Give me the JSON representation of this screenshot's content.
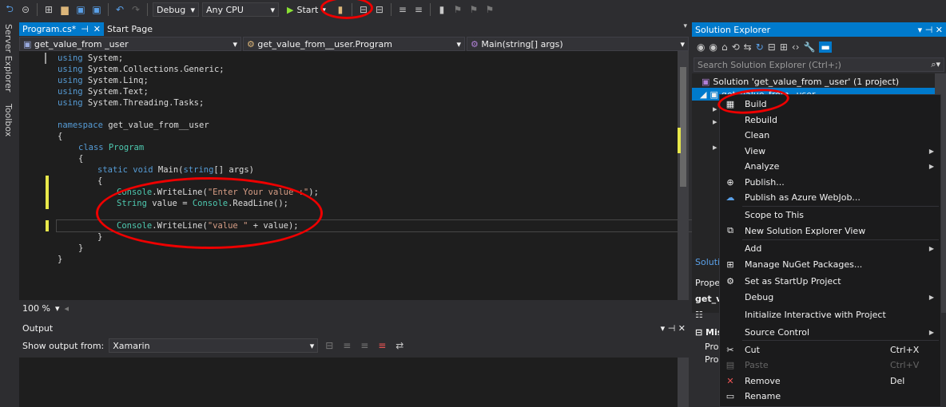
{
  "toolbar": {
    "config": "Debug",
    "platform": "Any CPU",
    "start_label": "Start"
  },
  "left_strip": {
    "server_explorer": "Server Explorer",
    "toolbox": "Toolbox"
  },
  "tabs": [
    {
      "label": "Program.cs*",
      "active": true
    },
    {
      "label": "Start Page",
      "active": false
    }
  ],
  "nav": {
    "project": "get_value_from _user",
    "class": "get_value_from__user.Program",
    "member": "Main(string[] args)"
  },
  "code": {
    "l1": "using System;",
    "l2": "using System.Collections.Generic;",
    "l3": "using System.Linq;",
    "l4": "using System.Text;",
    "l5": "using System.Threading.Tasks;",
    "l7kw": "namespace",
    "l7rest": " get_value_from__user",
    "l8": "{",
    "l9kw": "class",
    "l9ty": " Program",
    "l10": "{",
    "l11a": "static void",
    "l11b": " Main(",
    "l11c": "string",
    "l11d": "[] args)",
    "l12": "{",
    "l13a": "Console",
    "l13b": ".WriteLine(",
    "l13c": "\"Enter Your value :\"",
    "l13d": ");",
    "l14a": "String",
    "l14b": " value = ",
    "l14c": "Console",
    "l14d": ".ReadLine();",
    "l16a": "Console",
    "l16b": ".WriteLine(",
    "l16c": "\"value \"",
    "l16d": " + value);",
    "l17": "}",
    "l18": "}",
    "l19": "}"
  },
  "zoom": "100 %",
  "output": {
    "title": "Output",
    "show_from_label": "Show output from:",
    "source": "Xamarin"
  },
  "solution_explorer": {
    "title": "Solution Explorer",
    "search_placeholder": "Search Solution Explorer (Ctrl+;)",
    "solution_label": "Solution 'get_value_from _user' (1 project)",
    "project_label": "get_value_from _user",
    "partial_tab": "Solutio",
    "partial_props": "Proper",
    "partial_getv": "get_v",
    "partial_mis": "Mis",
    "partial_pro1": "Pro",
    "partial_pro2": "Pro"
  },
  "context_menu": [
    {
      "label": "Build",
      "icon": "build-icon"
    },
    {
      "label": "Rebuild"
    },
    {
      "label": "Clean"
    },
    {
      "label": "View",
      "submenu": true
    },
    {
      "label": "Analyze",
      "submenu": true
    },
    {
      "label": "Publish...",
      "icon": "globe-icon"
    },
    {
      "label": "Publish as Azure WebJob...",
      "icon": "cloud-icon"
    },
    {
      "label": "Scope to This"
    },
    {
      "label": "New Solution Explorer View",
      "icon": "window-icon"
    },
    {
      "label": "Add",
      "submenu": true
    },
    {
      "label": "Manage NuGet Packages...",
      "icon": "nuget-icon"
    },
    {
      "label": "Set as StartUp Project",
      "icon": "gear-icon"
    },
    {
      "label": "Debug",
      "submenu": true
    },
    {
      "label": "Initialize Interactive with Project"
    },
    {
      "label": "Source Control",
      "submenu": true
    },
    {
      "label": "Cut",
      "shortcut": "Ctrl+X",
      "icon": "scissors-icon"
    },
    {
      "label": "Paste",
      "shortcut": "Ctrl+V",
      "disabled": true,
      "icon": "paste-icon"
    },
    {
      "label": "Remove",
      "shortcut": "Del",
      "icon": "x-icon"
    },
    {
      "label": "Rename",
      "icon": "rename-icon"
    }
  ],
  "colors": {
    "accent": "#007acc",
    "annotation": "#ee0000"
  }
}
